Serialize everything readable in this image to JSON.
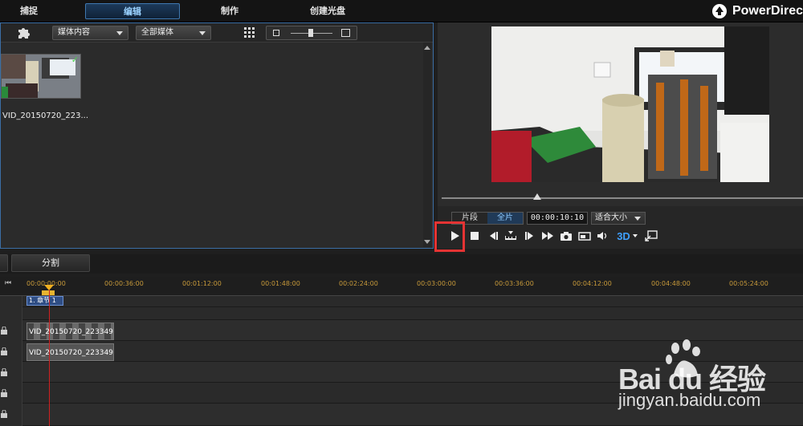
{
  "header": {
    "tabs": [
      {
        "label": "捕捉"
      },
      {
        "label": "编辑",
        "active": true
      },
      {
        "label": "制作"
      },
      {
        "label": "创建光盘"
      }
    ],
    "brand": "PowerDirec"
  },
  "library": {
    "dropdown_content": "媒体内容",
    "dropdown_filter": "全部媒体",
    "thumbnail_name": "VID_20150720_223...",
    "icons": [
      "puzzle-icon",
      "grid-view-icon",
      "zoom-small-icon",
      "zoom-large-icon",
      "checkmark-icon"
    ]
  },
  "preview": {
    "mode_clip": "片段",
    "mode_full": "全片",
    "timecode": "00:00:10:10",
    "fit_label": "适合大小",
    "threed_label": "3D",
    "controls": [
      "play-icon",
      "stop-icon",
      "previous-frame-icon",
      "mark-icon",
      "next-frame-icon",
      "fast-forward-icon",
      "snapshot-icon",
      "aspect-icon",
      "volume-icon",
      "3d-icon",
      "fullscreen-icon"
    ]
  },
  "toolbar": {
    "split_label": "分割"
  },
  "timeline": {
    "ticks": [
      "00:00:00:00",
      "00:00:36:00",
      "00:01:12:00",
      "00:01:48:00",
      "00:02:24:00",
      "00:03:00:00",
      "00:03:36:00",
      "00:04:12:00",
      "00:04:48:00",
      "00:05:24:00"
    ],
    "chapter": "1. 章节 1",
    "video_clip": "VID_20150720_223349",
    "audio_clip": "VID_20150720_223349"
  },
  "watermark": {
    "logo": "Bai  du 经验",
    "url": "jingyan.baidu.com"
  },
  "colors": {
    "accent": "#3f78b0",
    "highlight": "#e53333",
    "playhead": "#d02020"
  }
}
